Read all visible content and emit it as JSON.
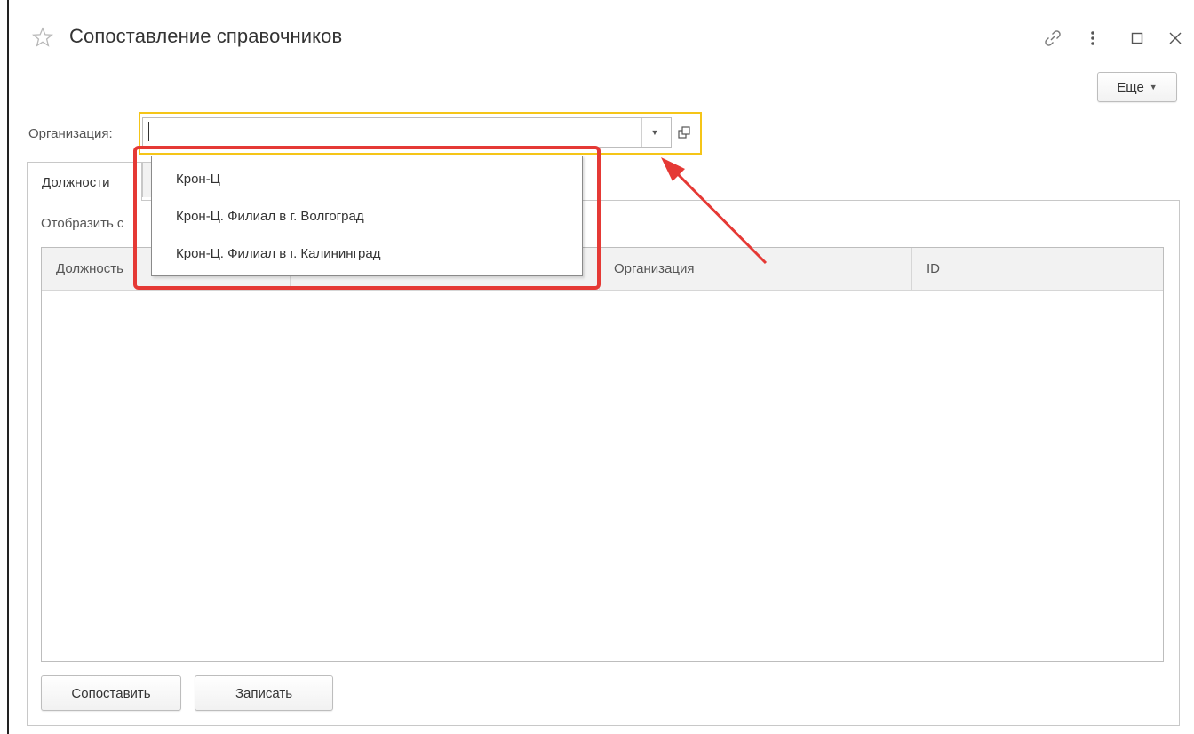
{
  "window": {
    "title": "Сопоставление справочников",
    "icons": [
      "star-icon",
      "link-icon",
      "more-vertical-icon",
      "maximize-icon",
      "close-icon"
    ]
  },
  "toolbar": {
    "more_label": "Еще",
    "more_icon": "caret-down-icon"
  },
  "organization": {
    "label": "Организация:",
    "value": "",
    "dropdown_icon": "caret-down-icon",
    "open_icon": "open-form-icon",
    "options": [
      "Крон-Ц",
      "Крон-Ц. Филиал в г. Волгоград",
      "Крон-Ц. Филиал в г. Калининград"
    ]
  },
  "tabs": [
    {
      "label": "Должности",
      "active": true
    },
    {
      "label": "",
      "active": false
    }
  ],
  "panel": {
    "show_label": "Отобразить с"
  },
  "table": {
    "columns": [
      "Должность",
      "",
      "Организация",
      "ID"
    ],
    "rows": []
  },
  "buttons": {
    "match_label": "Сопоставить",
    "save_label": "Записать"
  },
  "annotations": {
    "highlight_color": "#f5c518",
    "callout_color": "#e53935"
  }
}
